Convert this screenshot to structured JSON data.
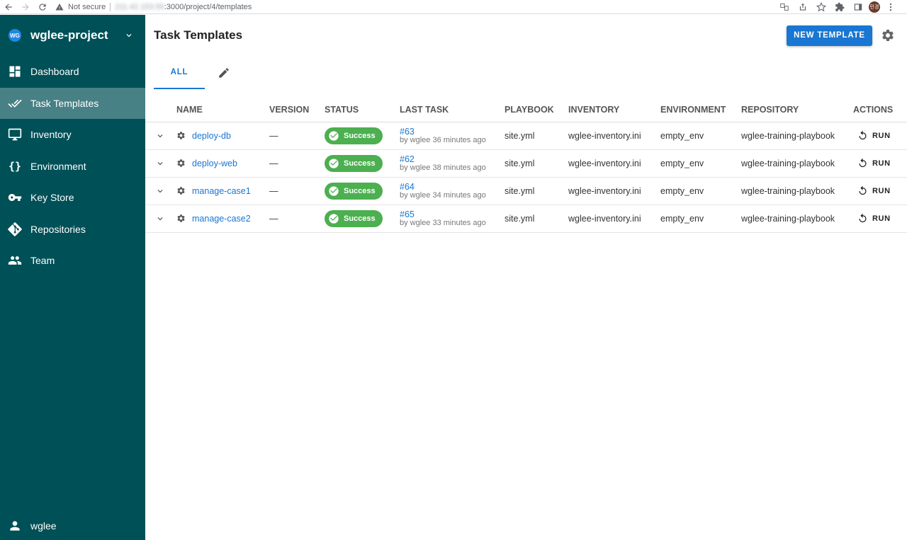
{
  "browser": {
    "security": "Not secure",
    "host": "211.42.153.55",
    "path": ":3000/project/4/templates",
    "profile_initials": "민경"
  },
  "sidebar": {
    "project_badge": "WG",
    "project_name": "wglee-project",
    "items": [
      {
        "label": "Dashboard",
        "icon": "dashboard-icon"
      },
      {
        "label": "Task Templates",
        "icon": "done-all-icon",
        "active": true
      },
      {
        "label": "Inventory",
        "icon": "monitor-icon"
      },
      {
        "label": "Environment",
        "icon": "braces-icon"
      },
      {
        "label": "Key Store",
        "icon": "key-icon"
      },
      {
        "label": "Repositories",
        "icon": "git-icon"
      },
      {
        "label": "Team",
        "icon": "team-icon"
      }
    ],
    "braces": "{}",
    "user": "wglee"
  },
  "header": {
    "title": "Task Templates",
    "new_button": "NEW TEMPLATE"
  },
  "tabs": {
    "all": "ALL"
  },
  "table": {
    "columns": [
      "NAME",
      "VERSION",
      "STATUS",
      "LAST TASK",
      "PLAYBOOK",
      "INVENTORY",
      "ENVIRONMENT",
      "REPOSITORY",
      "ACTIONS"
    ],
    "rows": [
      {
        "name": "deploy-db",
        "version": "—",
        "status": "Success",
        "last_id": "#63",
        "last_by": "by wglee 36 minutes ago",
        "playbook": "site.yml",
        "inventory": "wglee-inventory.ini",
        "environment": "empty_env",
        "repository": "wglee-training-playbook",
        "action": "RUN"
      },
      {
        "name": "deploy-web",
        "version": "—",
        "status": "Success",
        "last_id": "#62",
        "last_by": "by wglee 38 minutes ago",
        "playbook": "site.yml",
        "inventory": "wglee-inventory.ini",
        "environment": "empty_env",
        "repository": "wglee-training-playbook",
        "action": "RUN"
      },
      {
        "name": "manage-case1",
        "version": "—",
        "status": "Success",
        "last_id": "#64",
        "last_by": "by wglee 34 minutes ago",
        "playbook": "site.yml",
        "inventory": "wglee-inventory.ini",
        "environment": "empty_env",
        "repository": "wglee-training-playbook",
        "action": "RUN"
      },
      {
        "name": "manage-case2",
        "version": "—",
        "status": "Success",
        "last_id": "#65",
        "last_by": "by wglee 33 minutes ago",
        "playbook": "site.yml",
        "inventory": "wglee-inventory.ini",
        "environment": "empty_env",
        "repository": "wglee-training-playbook",
        "action": "RUN"
      }
    ]
  },
  "colors": {
    "sidebar_bg": "#005057",
    "primary": "#1976d2",
    "success": "#4caf50"
  }
}
